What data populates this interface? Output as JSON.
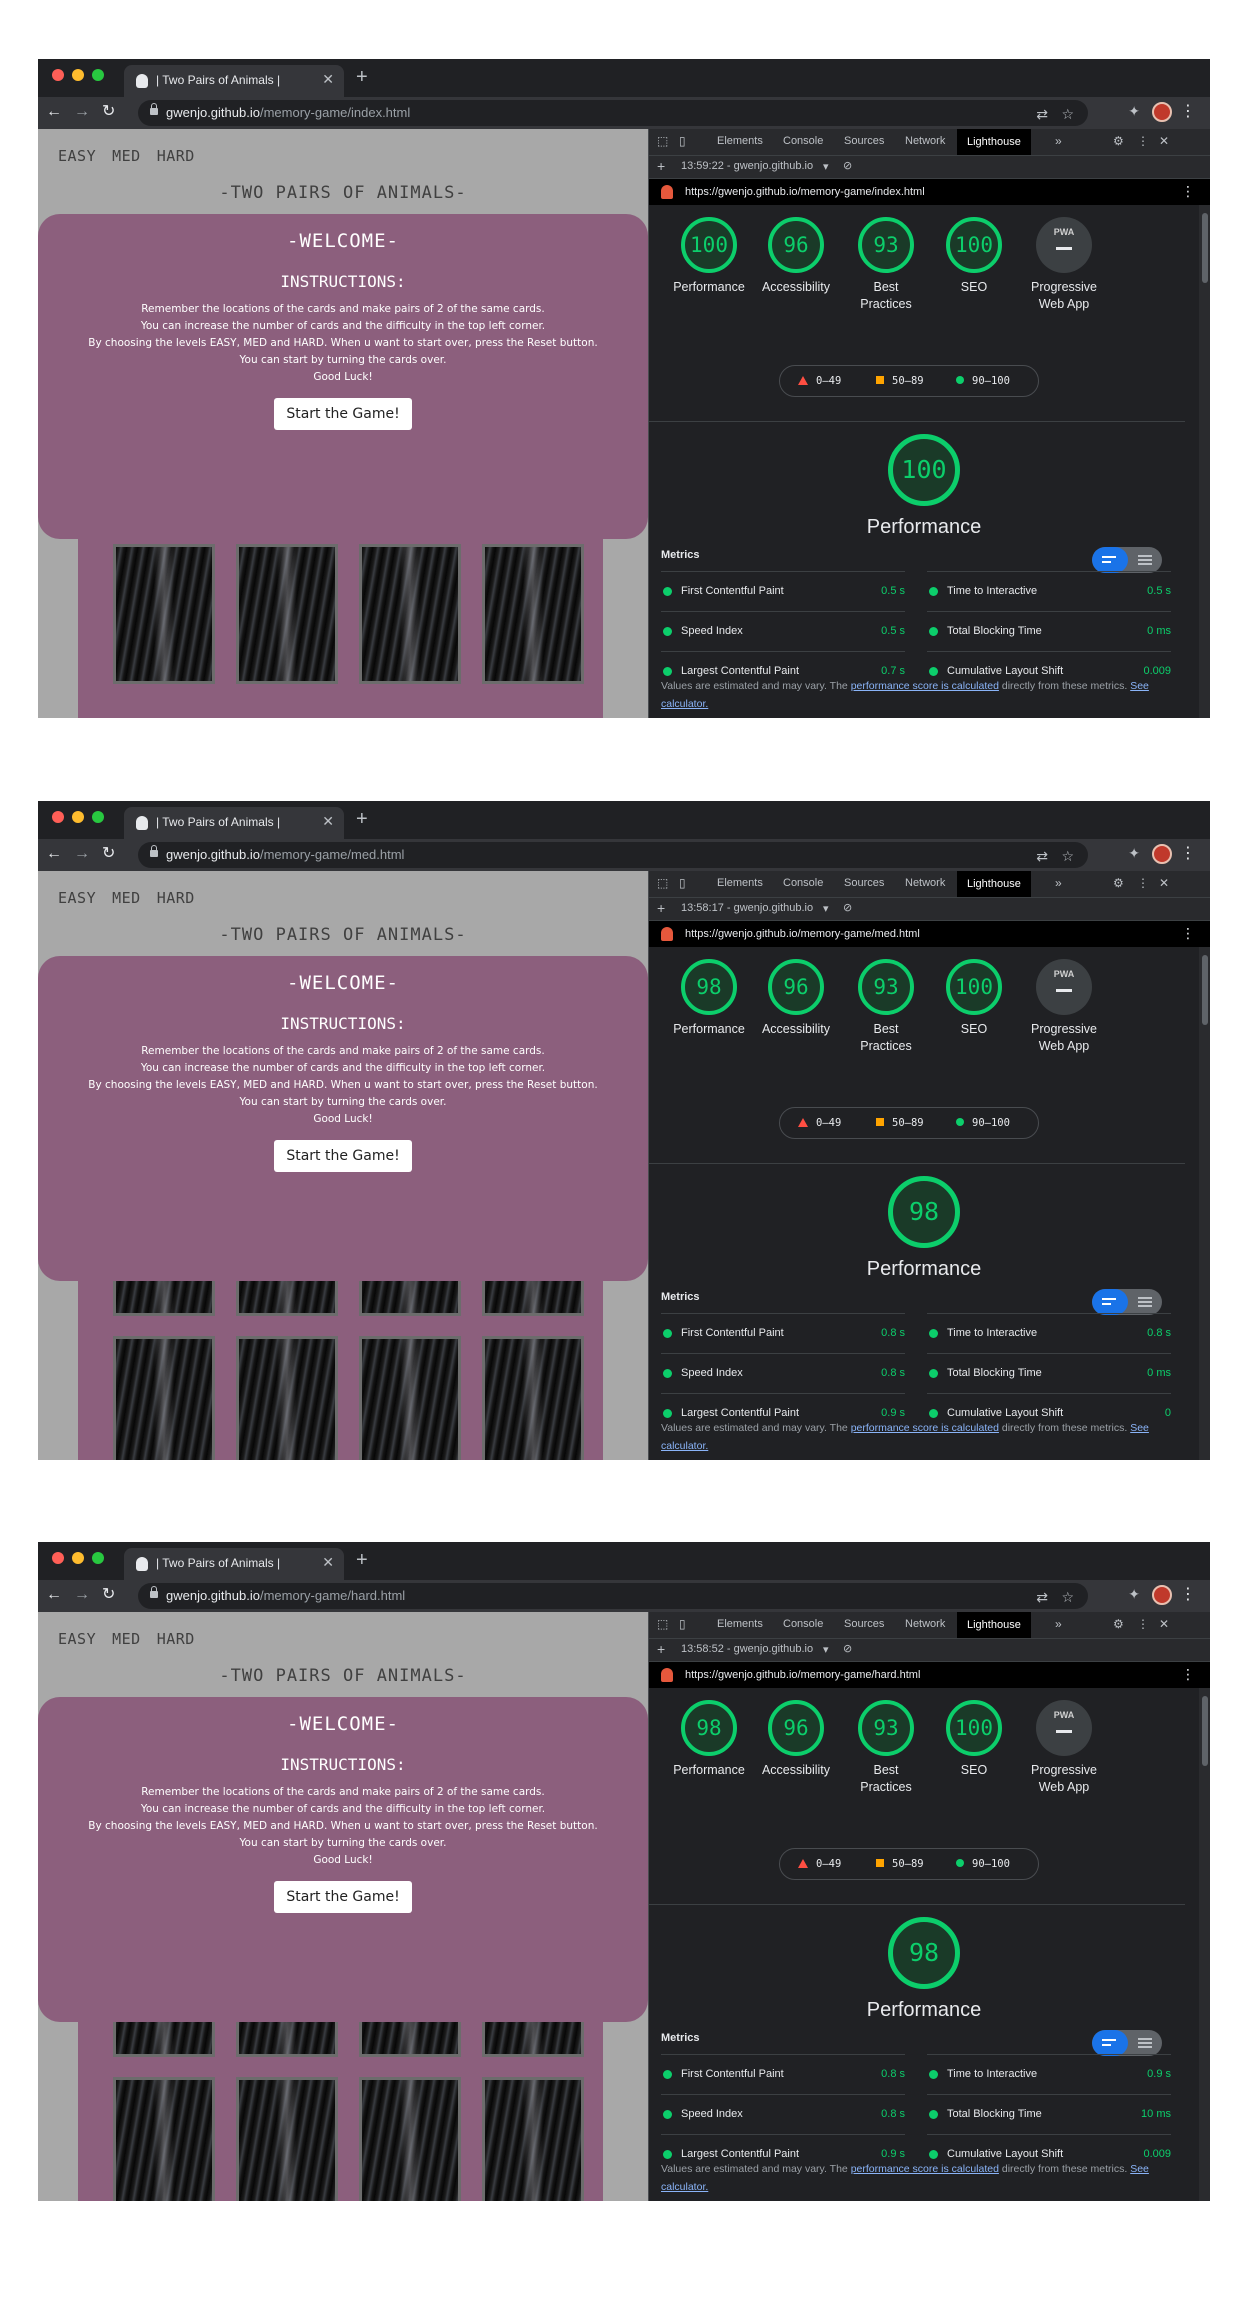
{
  "colors": {
    "score_green": "#0cce6b",
    "card_purple": "#8c5f7d",
    "page_grey": "#a8a8a8"
  },
  "screens": [
    {
      "tab_title": "| Two Pairs of Animals |",
      "url_host": "gwenjo.github.io",
      "url_path": "/memory-game/index.html",
      "levels": [
        "EASY",
        "MED",
        "HARD"
      ],
      "game_title": "-TWO PAIRS OF ANIMALS-",
      "welcome_title": "-WELCOME-",
      "instructions_title": "INSTRUCTIONS:",
      "instructions": [
        "Remember the locations of the cards and make pairs of 2 of the same cards.",
        "You can increase the number of cards and the difficulty in the top left corner.",
        "By choosing the levels EASY, MED and HARD. When u want to start over, press the Reset button.",
        "You can start by turning the cards over.",
        "Good Luck!"
      ],
      "start_label": "Start the Game!",
      "devtools_tabs": [
        "Elements",
        "Console",
        "Sources",
        "Network",
        "Lighthouse"
      ],
      "report_time": "13:59:22 - gwenjo.github.io",
      "report_url": "https://gwenjo.github.io/memory-game/index.html",
      "scores": [
        {
          "value": "100",
          "label": "Performance"
        },
        {
          "value": "96",
          "label": "Accessibility"
        },
        {
          "value": "93",
          "label": "Best Practices"
        },
        {
          "value": "100",
          "label": "SEO"
        }
      ],
      "pwa_label": "Progressive Web App",
      "pwa_badge": "PWA",
      "legend": [
        "0–49",
        "50–89",
        "90–100"
      ],
      "perf_score": "100",
      "perf_title": "Performance",
      "metrics_header": "Metrics",
      "metrics": [
        {
          "name": "First Contentful Paint",
          "value": "0.5 s"
        },
        {
          "name": "Time to Interactive",
          "value": "0.5 s"
        },
        {
          "name": "Speed Index",
          "value": "0.5 s"
        },
        {
          "name": "Total Blocking Time",
          "value": "0 ms"
        },
        {
          "name": "Largest Contentful Paint",
          "value": "0.7 s"
        },
        {
          "name": "Cumulative Layout Shift",
          "value": "0.009"
        }
      ],
      "note_pre": "Values are estimated and may vary. The ",
      "note_link": "performance score is calculated",
      "note_mid": " directly from these metrics. ",
      "note_calc": "See calculator."
    },
    {
      "tab_title": "| Two Pairs of Animals |",
      "url_host": "gwenjo.github.io",
      "url_path": "/memory-game/med.html",
      "levels": [
        "EASY",
        "MED",
        "HARD"
      ],
      "game_title": "-TWO PAIRS OF ANIMALS-",
      "welcome_title": "-WELCOME-",
      "instructions_title": "INSTRUCTIONS:",
      "instructions": [
        "Remember the locations of the cards and make pairs of 2 of the same cards.",
        "You can increase the number of cards and the difficulty in the top left corner.",
        "By choosing the levels EASY, MED and HARD. When u want to start over, press the Reset button.",
        "You can start by turning the cards over.",
        "Good Luck!"
      ],
      "start_label": "Start the Game!",
      "devtools_tabs": [
        "Elements",
        "Console",
        "Sources",
        "Network",
        "Lighthouse"
      ],
      "report_time": "13:58:17 - gwenjo.github.io",
      "report_url": "https://gwenjo.github.io/memory-game/med.html",
      "scores": [
        {
          "value": "98",
          "label": "Performance"
        },
        {
          "value": "96",
          "label": "Accessibility"
        },
        {
          "value": "93",
          "label": "Best Practices"
        },
        {
          "value": "100",
          "label": "SEO"
        }
      ],
      "pwa_label": "Progressive Web App",
      "pwa_badge": "PWA",
      "legend": [
        "0–49",
        "50–89",
        "90–100"
      ],
      "perf_score": "98",
      "perf_title": "Performance",
      "metrics_header": "Metrics",
      "metrics": [
        {
          "name": "First Contentful Paint",
          "value": "0.8 s"
        },
        {
          "name": "Time to Interactive",
          "value": "0.8 s"
        },
        {
          "name": "Speed Index",
          "value": "0.8 s"
        },
        {
          "name": "Total Blocking Time",
          "value": "0 ms"
        },
        {
          "name": "Largest Contentful Paint",
          "value": "0.9 s"
        },
        {
          "name": "Cumulative Layout Shift",
          "value": "0"
        }
      ],
      "note_pre": "Values are estimated and may vary. The ",
      "note_link": "performance score is calculated",
      "note_mid": " directly from these metrics. ",
      "note_calc": "See calculator."
    },
    {
      "tab_title": "| Two Pairs of Animals |",
      "url_host": "gwenjo.github.io",
      "url_path": "/memory-game/hard.html",
      "levels": [
        "EASY",
        "MED",
        "HARD"
      ],
      "game_title": "-TWO PAIRS OF ANIMALS-",
      "welcome_title": "-WELCOME-",
      "instructions_title": "INSTRUCTIONS:",
      "instructions": [
        "Remember the locations of the cards and make pairs of 2 of the same cards.",
        "You can increase the number of cards and the difficulty in the top left corner.",
        "By choosing the levels EASY, MED and HARD. When u want to start over, press the Reset button.",
        "You can start by turning the cards over.",
        "Good Luck!"
      ],
      "start_label": "Start the Game!",
      "devtools_tabs": [
        "Elements",
        "Console",
        "Sources",
        "Network",
        "Lighthouse"
      ],
      "report_time": "13:58:52 - gwenjo.github.io",
      "report_url": "https://gwenjo.github.io/memory-game/hard.html",
      "scores": [
        {
          "value": "98",
          "label": "Performance"
        },
        {
          "value": "96",
          "label": "Accessibility"
        },
        {
          "value": "93",
          "label": "Best Practices"
        },
        {
          "value": "100",
          "label": "SEO"
        }
      ],
      "pwa_label": "Progressive Web App",
      "pwa_badge": "PWA",
      "legend": [
        "0–49",
        "50–89",
        "90–100"
      ],
      "perf_score": "98",
      "perf_title": "Performance",
      "metrics_header": "Metrics",
      "metrics": [
        {
          "name": "First Contentful Paint",
          "value": "0.8 s"
        },
        {
          "name": "Time to Interactive",
          "value": "0.9 s"
        },
        {
          "name": "Speed Index",
          "value": "0.8 s"
        },
        {
          "name": "Total Blocking Time",
          "value": "10 ms"
        },
        {
          "name": "Largest Contentful Paint",
          "value": "0.9 s"
        },
        {
          "name": "Cumulative Layout Shift",
          "value": "0.009"
        }
      ],
      "note_pre": "Values are estimated and may vary. The ",
      "note_link": "performance score is calculated",
      "note_mid": " directly from these metrics. ",
      "note_calc": "See calculator."
    }
  ]
}
